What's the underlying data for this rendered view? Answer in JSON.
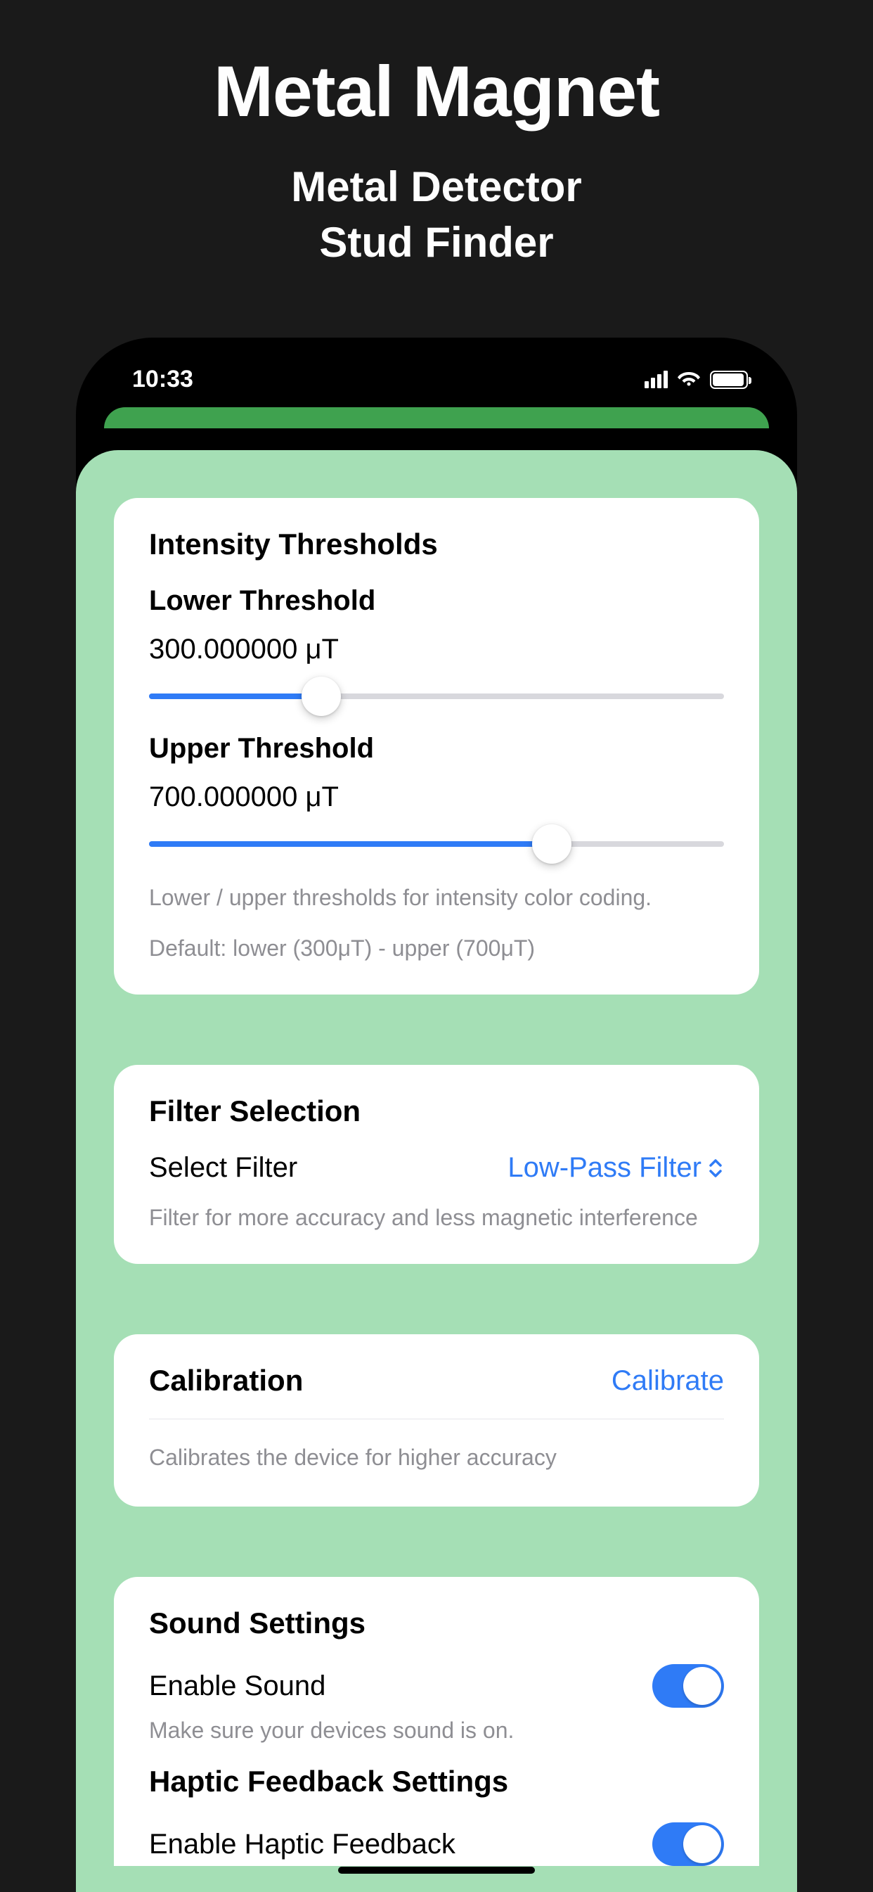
{
  "header": {
    "title": "Metal Magnet",
    "sub1": "Metal Detector",
    "sub2": "Stud Finder"
  },
  "status": {
    "time": "10:33"
  },
  "intensity": {
    "title": "Intensity Thresholds",
    "lower_label": "Lower Threshold",
    "lower_value": "300.000000 μT",
    "lower_percent": 30,
    "upper_label": "Upper Threshold",
    "upper_value": "700.000000 μT",
    "upper_percent": 70,
    "footer1": "Lower / upper thresholds for intensity color coding.",
    "footer2": "Default: lower (300μT) - upper (700μT)"
  },
  "filter": {
    "title": "Filter Selection",
    "label": "Select Filter",
    "value": "Low-Pass Filter",
    "footer": "Filter for more accuracy and less magnetic interference"
  },
  "calibration": {
    "title": "Calibration",
    "button": "Calibrate",
    "footer": "Calibrates the device for higher accuracy"
  },
  "sound": {
    "title": "Sound Settings",
    "enable_label": "Enable Sound",
    "enable_on": true,
    "hint": "Make sure your devices sound is on.",
    "haptic_title": "Haptic Feedback Settings",
    "haptic_label": "Enable Haptic Feedback",
    "haptic_on": true
  }
}
